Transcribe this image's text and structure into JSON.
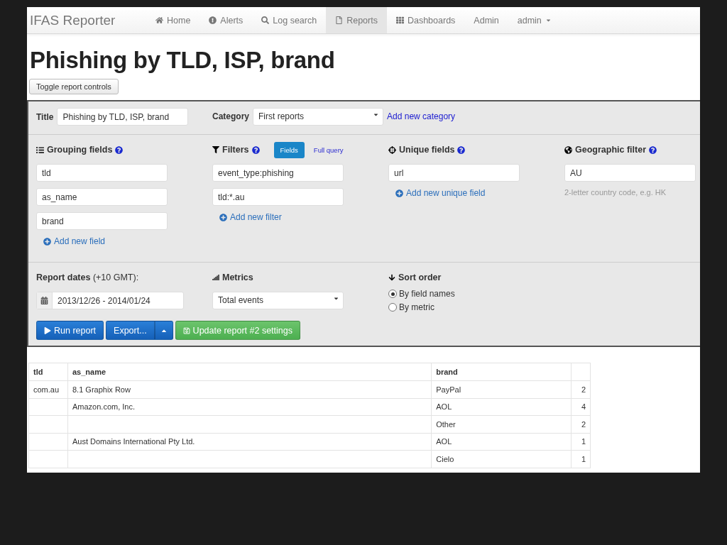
{
  "navbar": {
    "brand": "IFAS Reporter",
    "items": [
      {
        "label": "Home",
        "kind": "home",
        "selected": false
      },
      {
        "label": "Alerts",
        "kind": "alert",
        "selected": false
      },
      {
        "label": "Log search",
        "kind": "search",
        "selected": false
      },
      {
        "label": "Reports",
        "kind": "file",
        "selected": true
      },
      {
        "label": "Dashboards",
        "kind": "grid",
        "selected": false
      },
      {
        "label": "Admin",
        "kind": "text",
        "selected": false
      }
    ],
    "user": "admin"
  },
  "page_title": "Phishing by TLD, ISP, brand",
  "toggle_button": "Toggle report controls",
  "controls": {
    "title_label": "Title",
    "title_value": "Phishing by TLD, ISP, brand",
    "category_label": "Category",
    "category_value": "First reports",
    "add_category": "Add new category",
    "grouping": {
      "heading": "Grouping fields",
      "fields": [
        "tld",
        "as_name",
        "brand"
      ],
      "add": "Add new field"
    },
    "filters": {
      "heading": "Filters",
      "modes": [
        {
          "label": "Fields",
          "selected": true
        },
        {
          "label": "Full query",
          "selected": false
        }
      ],
      "fields": [
        "event_type:phishing",
        "tld:*.au"
      ],
      "add": "Add new filter"
    },
    "unique": {
      "heading": "Unique fields",
      "fields": [
        "url"
      ],
      "add": "Add new unique field"
    },
    "geo": {
      "heading": "Geographic filter",
      "value": "AU",
      "help": "2-letter country code, e.g. HK"
    },
    "dates": {
      "label": "Report dates",
      "note": "(+10 GMT):",
      "value": "2013/12/26 - 2014/01/24"
    },
    "metrics": {
      "heading": "Metrics",
      "value": "Total events"
    },
    "sort": {
      "heading": "Sort order",
      "options": [
        {
          "label": "By field names",
          "selected": true
        },
        {
          "label": "By metric",
          "selected": false
        }
      ]
    },
    "buttons": {
      "run": "Run report",
      "export": "Export...",
      "update": "Update report #2 settings"
    }
  },
  "table": {
    "columns": [
      "tld",
      "as_name",
      "brand"
    ],
    "rows": [
      {
        "tld": "com.au",
        "as_name": "8.1 Graphix Row",
        "brand": "PayPal",
        "column_4": "2"
      },
      {
        "as_name": "Amazon.com, Inc.",
        "brand": "AOL",
        "column_4": "4"
      },
      {
        "brand": "Other",
        "column_4": "2"
      },
      {
        "as_name": "Aust Domains International Pty Ltd.",
        "brand": "AOL",
        "column_4": "1"
      },
      {
        "brand": "Cielo",
        "column_4": "1"
      }
    ]
  }
}
